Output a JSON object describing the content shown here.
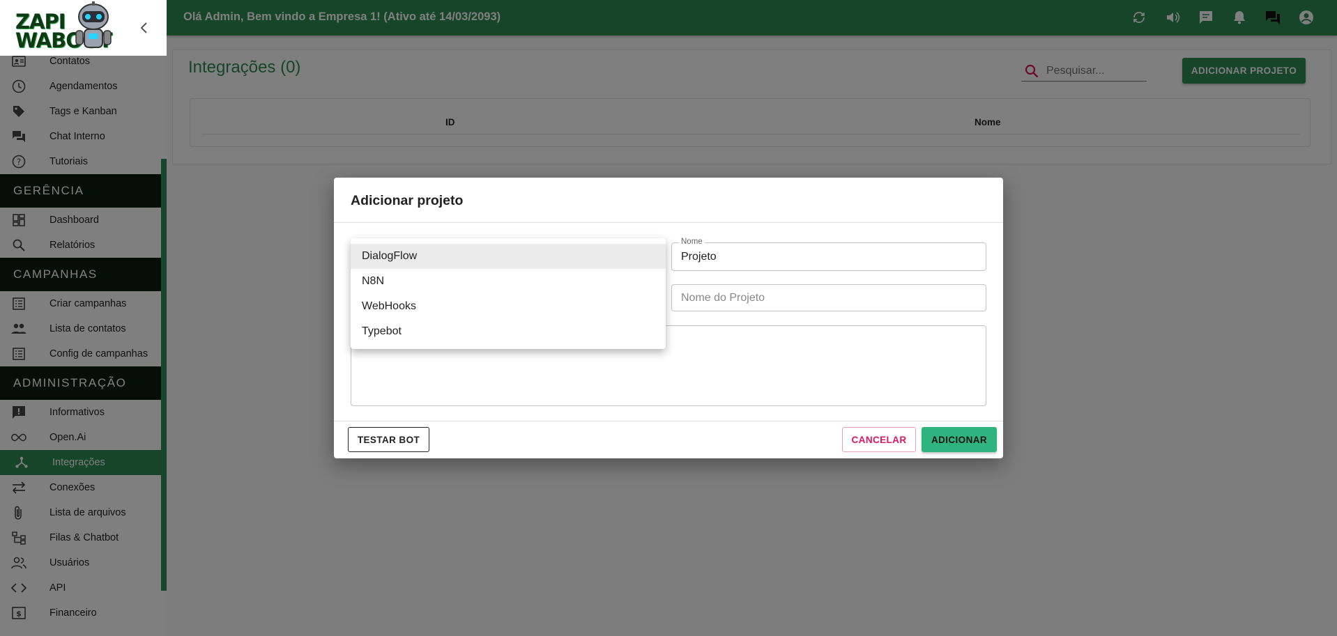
{
  "logo": {
    "line1": "ZAPI",
    "line2": "WABOOT"
  },
  "topbar": {
    "welcome": "Olá Admin, Bem vindo a Empresa 1! (Ativo até 14/03/2093)",
    "icons": [
      "refresh-icon",
      "volume-icon",
      "message-icon",
      "bell-icon",
      "chat-icon",
      "account-icon"
    ]
  },
  "sidebar": {
    "group1": [
      {
        "label": "Contatos",
        "icon": "contact-card-icon"
      },
      {
        "label": "Agendamentos",
        "icon": "clock-icon"
      },
      {
        "label": "Tags e Kanban",
        "icon": "tag-icon"
      },
      {
        "label": "Chat Interno",
        "icon": "forum-icon"
      },
      {
        "label": "Tutoriais",
        "icon": "help-icon"
      }
    ],
    "section_gerencia": "GERÊNCIA",
    "group2": [
      {
        "label": "Dashboard",
        "icon": "dashboard-icon"
      },
      {
        "label": "Relatórios",
        "icon": "search-icon"
      }
    ],
    "section_campanhas": "CAMPANHAS",
    "group3": [
      {
        "label": "Criar campanhas",
        "icon": "list-icon"
      },
      {
        "label": "Lista de contatos",
        "icon": "people-icon"
      },
      {
        "label": "Config de campanhas",
        "icon": "list-icon"
      }
    ],
    "section_admin": "ADMINISTRAÇÃO",
    "group4": [
      {
        "label": "Informativos",
        "icon": "announcement-icon"
      },
      {
        "label": "Open.Ai",
        "icon": "infinity-icon"
      },
      {
        "label": "Integrações",
        "icon": "hub-icon"
      },
      {
        "label": "Conexões",
        "icon": "swap-icon"
      },
      {
        "label": "Lista de arquivos",
        "icon": "attach-icon"
      },
      {
        "label": "Filas & Chatbot",
        "icon": "tree-icon"
      },
      {
        "label": "Usuários",
        "icon": "users-icon"
      },
      {
        "label": "API",
        "icon": "code-icon"
      },
      {
        "label": "Financeiro",
        "icon": "money-icon"
      }
    ]
  },
  "main": {
    "title": "Integrações (0)",
    "search_placeholder": "Pesquisar...",
    "add_button": "ADICIONAR PROJETO",
    "columns": [
      "ID",
      "Nome"
    ]
  },
  "dialog": {
    "title": "Adicionar projeto",
    "name_label": "Nome",
    "name_value": "Projeto",
    "project_name_placeholder": "Nome do Projeto",
    "test_button": "TESTAR BOT",
    "cancel_button": "CANCELAR",
    "add_button": "ADICIONAR"
  },
  "dropdown": {
    "selected": "DialogFlow",
    "options": [
      "DialogFlow",
      "N8N",
      "WebHooks",
      "Typebot"
    ]
  },
  "colors": {
    "primary": "#2d8a55",
    "section": "#0b1f10",
    "add_button": "#2db47f",
    "cancel": "#e0155f"
  }
}
